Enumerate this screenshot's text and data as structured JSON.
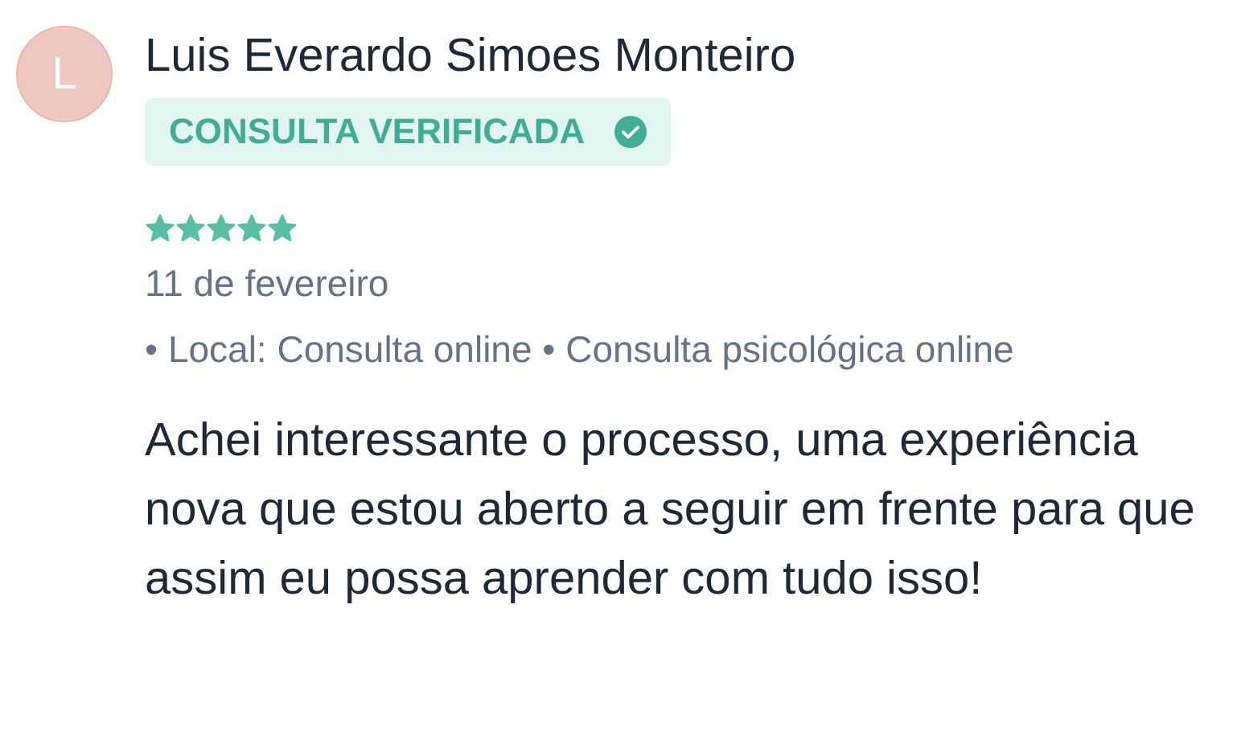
{
  "review": {
    "avatar_initial": "L",
    "author": "Luis Everardo Simoes Monteiro",
    "badge": {
      "label": "CONSULTA VERIFICADA",
      "verified": true
    },
    "stars": 5,
    "date": "11 de fevereiro",
    "details": "• Local: Consulta online • Consulta psicológica online",
    "text": "Achei interessante o processo, uma experiência nova que estou aberto a seguir em frente para que assim eu possa aprender com tudo isso!"
  }
}
